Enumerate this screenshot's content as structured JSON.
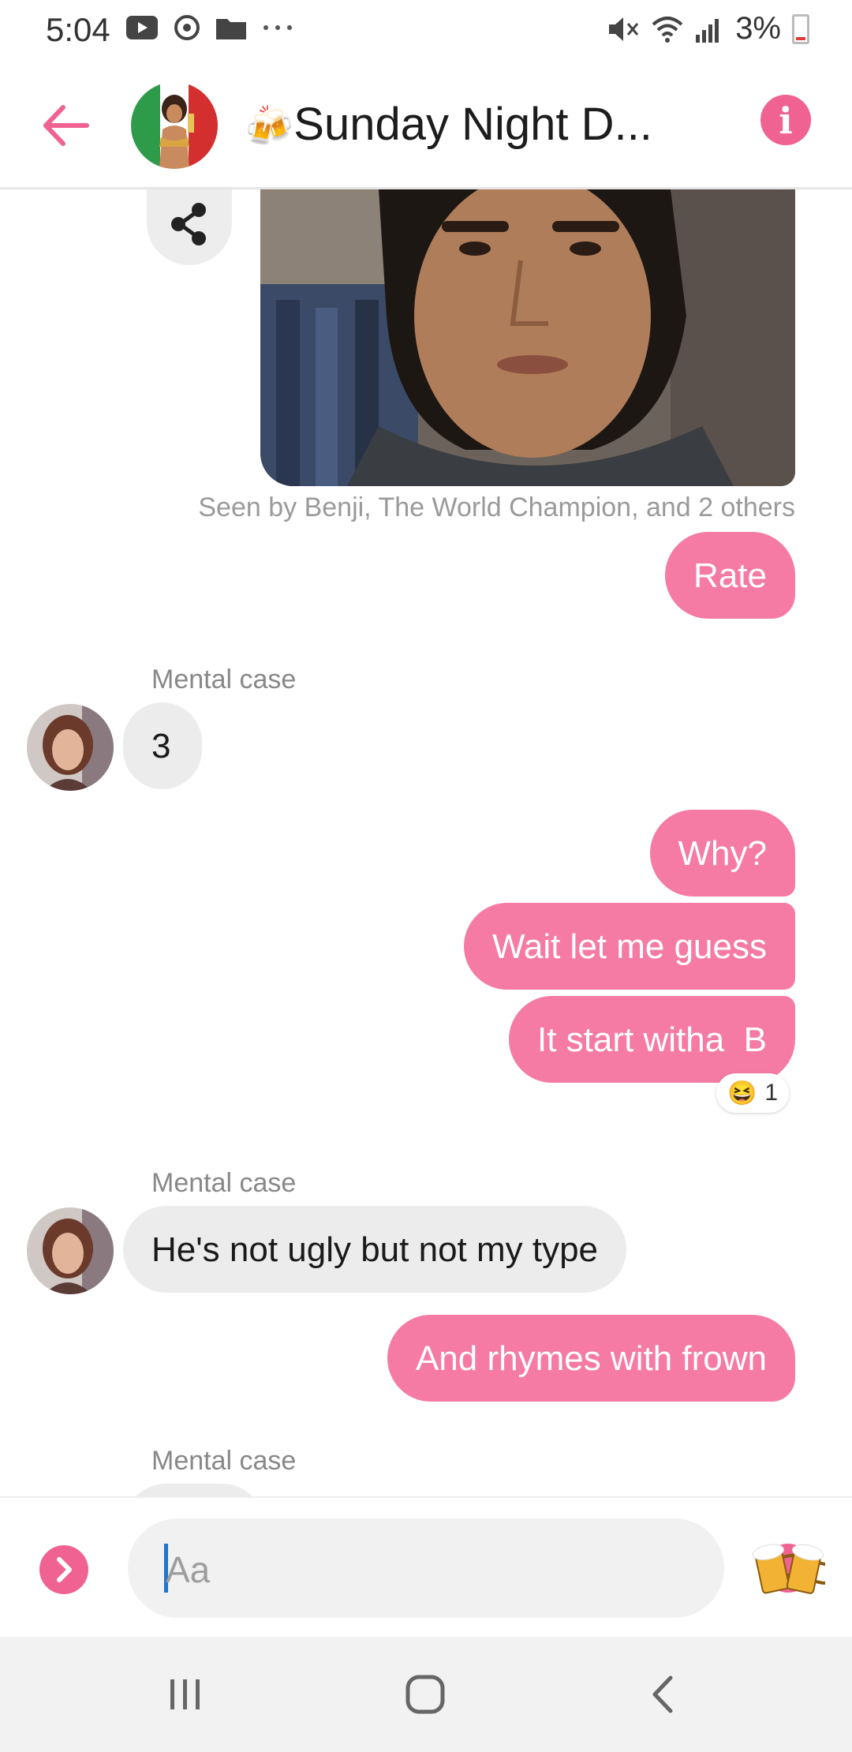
{
  "status_bar": {
    "time": "5:04",
    "battery_text": "3%",
    "icons": [
      "youtube-icon",
      "messenger-icon",
      "folder-icon",
      "more-icon",
      "mute-icon",
      "wifi-icon",
      "signal-icon",
      "battery-icon"
    ]
  },
  "header": {
    "title": "Sunday Night D...",
    "title_emoji": "🍻",
    "accent_color": "#f06292"
  },
  "messages": {
    "seen_text": "Seen by Benji, The World Champion, and 2 others",
    "m1": "Rate",
    "sender1": "Mental case",
    "m2": "3",
    "m3": "Why?",
    "m4": "Wait let me guess",
    "m5": "It start witha  B",
    "reaction_count": "1",
    "reaction_emoji": "😆",
    "sender2": "Mental case",
    "m6": "He's not ugly but not my type",
    "m7": "And rhymes with frown",
    "sender3": "Mental case"
  },
  "composer": {
    "placeholder": "Aa"
  },
  "colors": {
    "outgoing_bubble": "#f57ba4",
    "incoming_bubble": "#ececec",
    "accent": "#f06292"
  }
}
